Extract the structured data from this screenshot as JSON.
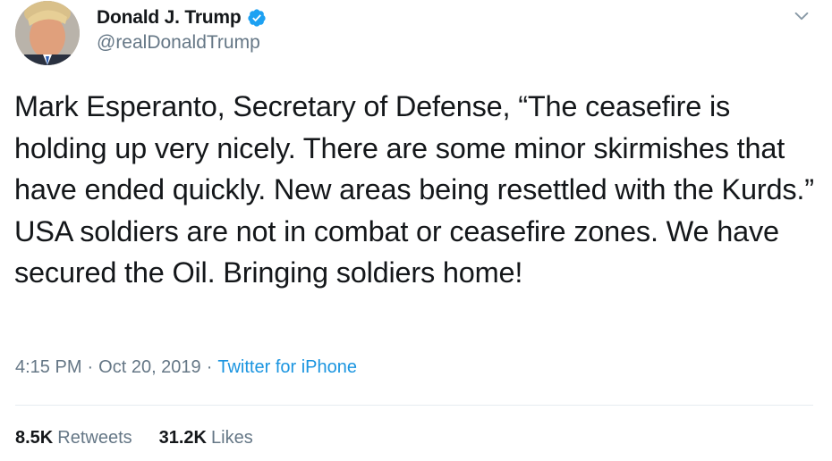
{
  "author": {
    "display_name": "Donald J. Trump",
    "handle": "@realDonaldTrump",
    "verified_icon": "verified-badge-icon",
    "avatar_icon": "profile-avatar"
  },
  "menu": {
    "caret_icon": "chevron-down-icon"
  },
  "tweet": {
    "text": "Mark Esperanto, Secretary of Defense, “The ceasefire is holding up very nicely. There are some minor skirmishes that have ended quickly. New areas being resettled with the Kurds.” USA soldiers are not in combat or ceasefire zones. We have secured the Oil. Bringing soldiers home!",
    "time": "4:15 PM",
    "date": "Oct 20, 2019",
    "separator": "·",
    "source": "Twitter for iPhone"
  },
  "stats": {
    "retweets_count": "8.5K",
    "retweets_label": "Retweets",
    "likes_count": "31.2K",
    "likes_label": "Likes"
  },
  "colors": {
    "text": "#14171a",
    "muted": "#657786",
    "link": "#1b95e0",
    "verified": "#1da1f2",
    "divider": "#e6ecf0"
  }
}
